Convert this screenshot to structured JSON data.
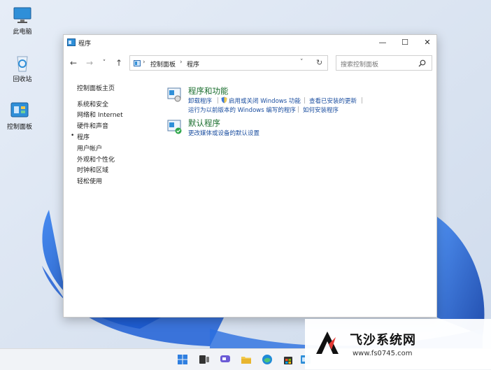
{
  "desktop": {
    "icons": [
      {
        "label": "此电脑",
        "icon": "monitor-icon"
      },
      {
        "label": "回收站",
        "icon": "recycle-bin-icon"
      },
      {
        "label": "控制面板",
        "icon": "control-panel-icon"
      }
    ]
  },
  "window": {
    "title": "程序",
    "controls": {
      "minimize": "—",
      "maximize": "☐",
      "close": "✕"
    },
    "nav": {
      "back": "←",
      "forward": "→",
      "recent": "˅",
      "up": "↑"
    },
    "address": {
      "segments": [
        "控制面板",
        "程序"
      ],
      "separator": "›",
      "dropdown": "˅",
      "refresh": "↻"
    },
    "search": {
      "placeholder": "搜索控制面板",
      "icon": "search-icon"
    }
  },
  "sidebar": {
    "items": [
      {
        "label": "控制面板主页",
        "current": false
      },
      {
        "label": "系统和安全",
        "current": false
      },
      {
        "label": "网络和 Internet",
        "current": false
      },
      {
        "label": "硬件和声音",
        "current": false
      },
      {
        "label": "程序",
        "current": true
      },
      {
        "label": "用户帐户",
        "current": false
      },
      {
        "label": "外观和个性化",
        "current": false
      },
      {
        "label": "时钟和区域",
        "current": false
      },
      {
        "label": "轻松使用",
        "current": false
      }
    ],
    "current_marker": "•"
  },
  "categories": [
    {
      "title": "程序和功能",
      "icon": "programs-features-icon",
      "links_row1": [
        "卸载程序",
        "启用或关闭 Windows 功能",
        "查看已安装的更新"
      ],
      "links_row2": [
        "运行为以前版本的 Windows 编写的程序",
        "如何安装程序"
      ]
    },
    {
      "title": "默认程序",
      "icon": "default-programs-icon",
      "links_row1": [
        "更改媒体或设备的默认设置"
      ]
    }
  ],
  "taskbar": {
    "icons": [
      "windows-start-icon",
      "task-view-icon",
      "chat-icon",
      "file-explorer-icon",
      "edge-icon",
      "store-icon",
      "control-panel-icon"
    ]
  },
  "watermark": {
    "name": "飞沙系统网",
    "url": "www.fs0745.com"
  },
  "colors": {
    "category_title": "#1a6e2e",
    "link": "#1c4fa0",
    "wallpaper_accent": "#1f5fd6"
  }
}
